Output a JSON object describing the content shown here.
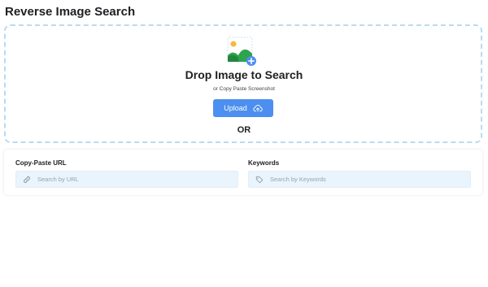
{
  "header": {
    "title": "Reverse Image Search"
  },
  "dropzone": {
    "icon": "image-add-icon",
    "title": "Drop Image to Search",
    "subtitle": "or Copy Paste Screenshot",
    "upload_label": "Upload",
    "upload_icon": "cloud-upload-icon",
    "or_text": "OR"
  },
  "url_field": {
    "label": "Copy-Paste URL",
    "placeholder": "Search by URL",
    "value": "",
    "icon": "link-icon"
  },
  "keywords_field": {
    "label": "Keywords",
    "placeholder": "Search by Keywords",
    "value": "",
    "icon": "tag-icon"
  },
  "colors": {
    "accent": "#4d8ff0",
    "dropzone_border": "#b8dbf2",
    "field_bg": "#e9f4fd"
  }
}
